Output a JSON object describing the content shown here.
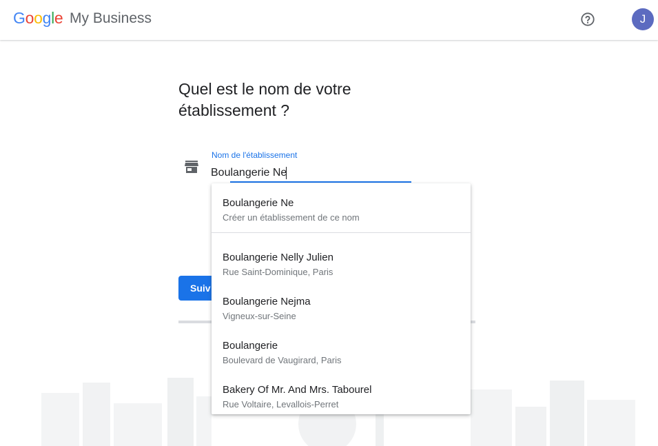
{
  "header": {
    "logo_letters": [
      "G",
      "o",
      "o",
      "g",
      "l",
      "e"
    ],
    "product_name": "My Business",
    "avatar_letter": "J"
  },
  "main": {
    "title": "Quel est le nom de votre établissement ?",
    "field_label": "Nom de l'établissement",
    "field_value": "Boulangerie Ne",
    "next_button_label": "Suiv"
  },
  "dropdown": {
    "create_option": {
      "title": "Boulangerie Ne",
      "subtitle": "Créer un établissement de ce nom"
    },
    "suggestions": [
      {
        "title": "Boulangerie Nelly Julien",
        "subtitle": "Rue Saint-Dominique, Paris"
      },
      {
        "title": "Boulangerie Nejma",
        "subtitle": "Vigneux-sur-Seine"
      },
      {
        "title": "Boulangerie",
        "subtitle": "Boulevard de Vaugirard, Paris"
      },
      {
        "title": "Bakery Of Mr. And Mrs. Tabourel",
        "subtitle": "Rue Voltaire, Levallois-Perret"
      }
    ]
  },
  "icons": {
    "help": "help-circle-icon",
    "store": "storefront-icon"
  },
  "colors": {
    "accent": "#1a73e8",
    "avatar": "#5c6bc0"
  }
}
